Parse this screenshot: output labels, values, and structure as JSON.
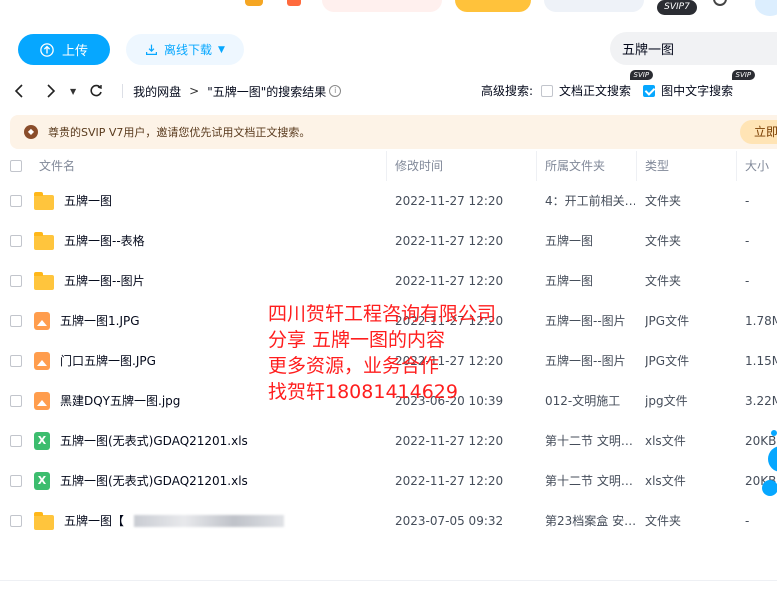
{
  "toolbar": {
    "upload_label": "上传",
    "offline_label": "离线下载",
    "search_value": "五牌一图"
  },
  "header": {
    "svip_badge": "SVIP7"
  },
  "breadcrumb": {
    "root": "我的网盘",
    "current": "\"五牌一图\"的搜索结果"
  },
  "advanced_search": {
    "label": "高级搜索:",
    "options": [
      {
        "label": "文档正文搜索",
        "checked": false,
        "tag": "SVIP"
      },
      {
        "label": "图中文字搜索",
        "checked": true,
        "tag": "SVIP"
      }
    ]
  },
  "notice": {
    "text": "尊贵的SVIP V7用户，邀请您优先试用文档正文搜索。",
    "action": "立即"
  },
  "table": {
    "columns": [
      "文件名",
      "修改时间",
      "所属文件夹",
      "类型",
      "大小"
    ],
    "rows": [
      {
        "icon": "folder-icon",
        "name": "五牌一图",
        "time": "2022-11-27 12:20",
        "folder": "4：开工前相关…",
        "type": "文件夹",
        "size": "-"
      },
      {
        "icon": "folder-icon",
        "name": "五牌一图--表格",
        "time": "2022-11-27 12:20",
        "folder": "五牌一图",
        "type": "文件夹",
        "size": "-"
      },
      {
        "icon": "folder-icon",
        "name": "五牌一图--图片",
        "time": "2022-11-27 12:20",
        "folder": "五牌一图",
        "type": "文件夹",
        "size": "-"
      },
      {
        "icon": "image-file-icon",
        "name": "五牌一图1.JPG",
        "time": "2022-11-27 12:20",
        "folder": "五牌一图--图片",
        "type": "JPG文件",
        "size": "1.78M"
      },
      {
        "icon": "image-file-icon",
        "name": "门口五牌一图.JPG",
        "time": "2022-11-27 12:20",
        "folder": "五牌一图--图片",
        "type": "JPG文件",
        "size": "1.15M"
      },
      {
        "icon": "image-file-icon",
        "name": "黑建DQY五牌一图.jpg",
        "time": "2023-06-20 10:39",
        "folder": "012-文明施工",
        "type": "jpg文件",
        "size": "3.22M"
      },
      {
        "icon": "excel-file-icon",
        "name": "五牌一图(无表式)GDAQ21201.xls",
        "time": "2022-11-27 12:20",
        "folder": "第十二节  文明…",
        "type": "xls文件",
        "size": "20KB"
      },
      {
        "icon": "excel-file-icon",
        "name": "五牌一图(无表式)GDAQ21201.xls",
        "time": "2022-11-27 12:20",
        "folder": "第十二节  文明…",
        "type": "xls文件",
        "size": "20KB"
      },
      {
        "icon": "folder-icon",
        "name": "五牌一图【",
        "time": "2023-07-05 09:32",
        "folder": "第23档案盒 安…",
        "type": "文件夹",
        "size": "-"
      }
    ]
  },
  "watermark": {
    "lines": [
      "四川贺轩工程咨询有限公司",
      "分享 五牌一图的内容",
      "更多资源，业务合作",
      "找贺轩18081414629"
    ]
  }
}
